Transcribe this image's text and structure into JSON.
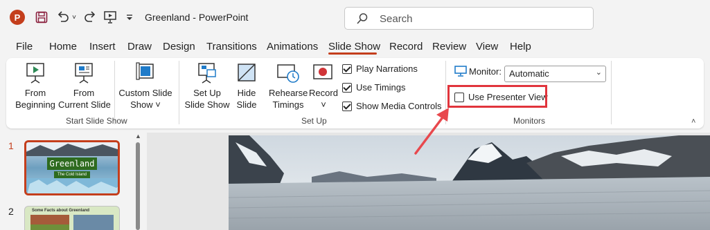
{
  "title_bar": {
    "document_title": "Greenland  -  PowerPoint",
    "app_logo_letter": "P",
    "search_placeholder": "Search",
    "quick_access_icons": [
      "powerpoint-logo-icon",
      "save-icon",
      "undo-icon",
      "undo-dropdown-icon",
      "redo-icon",
      "present-from-start-icon",
      "customize-qat-icon"
    ]
  },
  "tabs": [
    "File",
    "Home",
    "Insert",
    "Draw",
    "Design",
    "Transitions",
    "Animations",
    "Slide Show",
    "Record",
    "Review",
    "View",
    "Help"
  ],
  "active_tab": "Slide Show",
  "ribbon": {
    "start_slide_show": {
      "label": "Start Slide Show",
      "from_beginning": "From\nBeginning",
      "from_current": "From\nCurrent Slide",
      "custom_slide_show": "Custom Slide\nShow ˅"
    },
    "set_up": {
      "label": "Set Up",
      "set_up_slide_show": "Set Up\nSlide Show",
      "hide_slide": "Hide\nSlide",
      "rehearse_timings": "Rehearse\nTimings",
      "record": "Record",
      "record_chevron": "˅",
      "play_narrations": {
        "label": "Play Narrations",
        "checked": true
      },
      "use_timings": {
        "label": "Use Timings",
        "checked": true
      },
      "show_media_controls": {
        "label": "Show Media Controls",
        "checked": true
      }
    },
    "monitors": {
      "label": "Monitors",
      "monitor_label": "Monitor:",
      "monitor_value": "Automatic",
      "use_presenter_view": {
        "label": "Use Presenter View",
        "checked": false
      }
    }
  },
  "slides": [
    {
      "number": "1",
      "title": "Greenland",
      "subtitle": "The Cold Island",
      "selected": true
    },
    {
      "number": "2",
      "title": "Some Facts about Greenland",
      "selected": false
    }
  ],
  "colors": {
    "accent": "#c43e1c",
    "highlight_box": "#e1343c",
    "arrow": "#e8484d",
    "monitor_icon": "#1f7bc9"
  }
}
